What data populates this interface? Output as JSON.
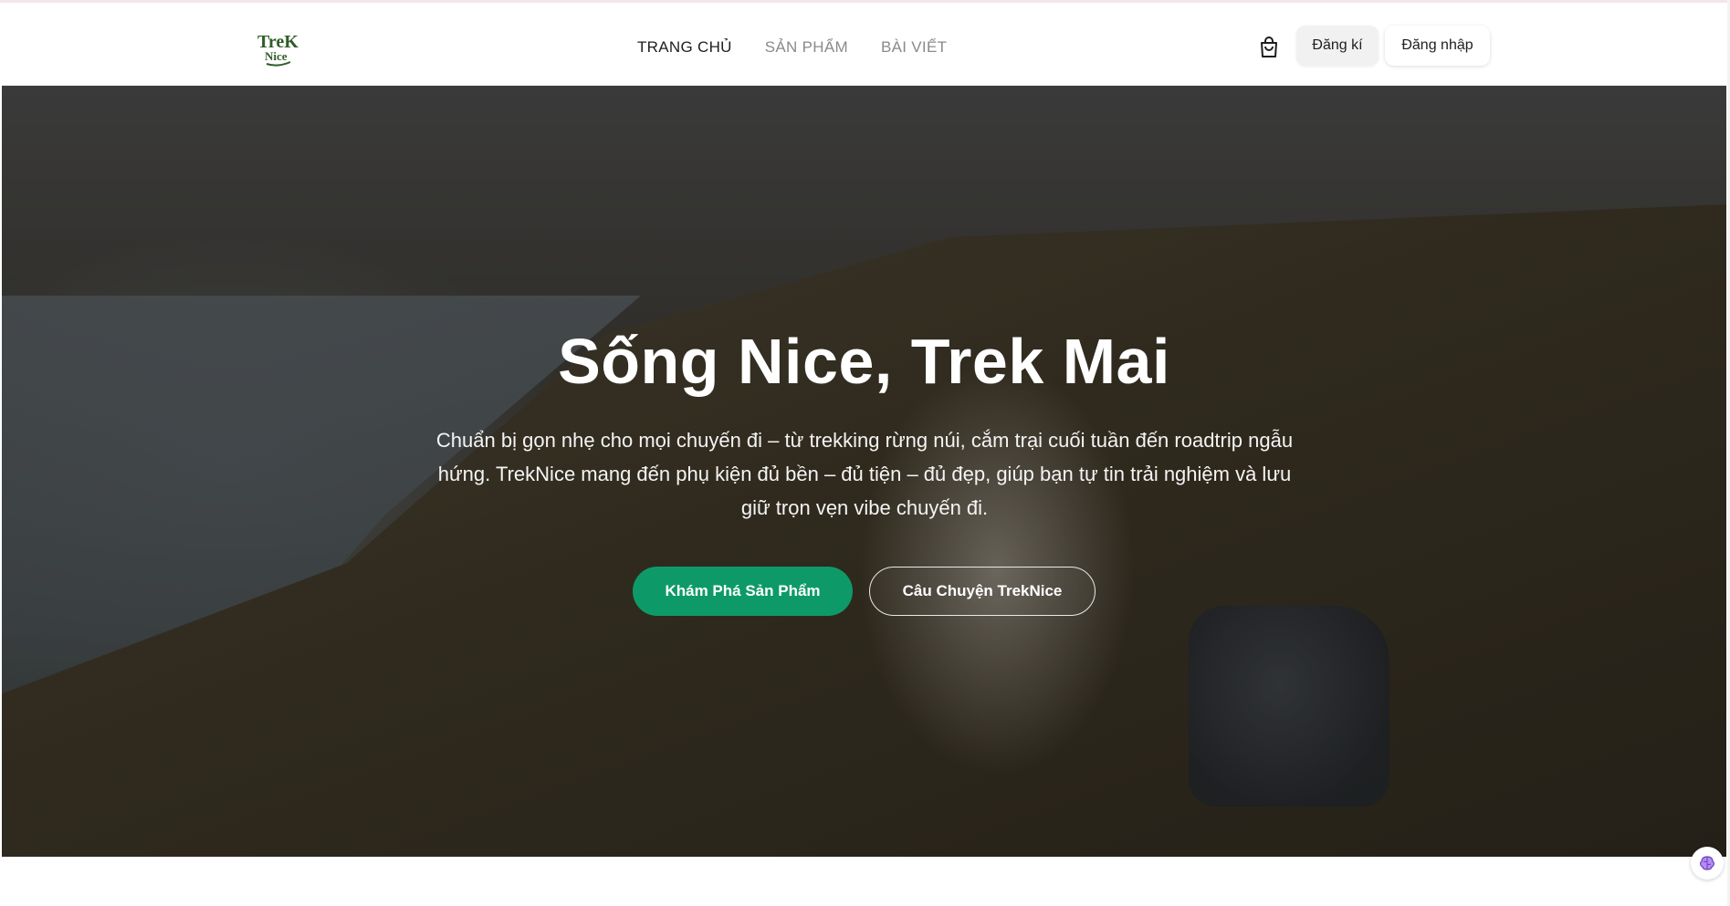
{
  "brand": {
    "logo_line1": "TreK",
    "logo_line2": "Nice",
    "color": "#2f5d2a"
  },
  "nav": {
    "items": [
      {
        "label": "TRANG CHỦ",
        "active": true
      },
      {
        "label": "SẢN PHẨM",
        "active": false
      },
      {
        "label": "BÀI VIẾT",
        "active": false
      }
    ]
  },
  "header": {
    "cart_icon": "shopping-bag-icon",
    "register_label": "Đăng kí",
    "login_label": "Đăng nhập"
  },
  "hero": {
    "title": "Sống Nice, Trek Mai",
    "subtitle": "Chuẩn bị gọn nhẹ cho mọi chuyến đi – từ trekking rừng núi, cắm trại cuối tuần đến roadtrip ngẫu hứng. TrekNice mang đến phụ kiện đủ bền – đủ tiện – đủ đẹp, giúp bạn tự tin trải nghiệm và lưu giữ trọn vẹn vibe chuyến đi.",
    "primary_cta": "Khám Phá Sản Phẩm",
    "secondary_cta": "Câu Chuyện TrekNice",
    "accent_color": "#0e9a68"
  },
  "floating_button": {
    "icon": "brain-icon"
  }
}
